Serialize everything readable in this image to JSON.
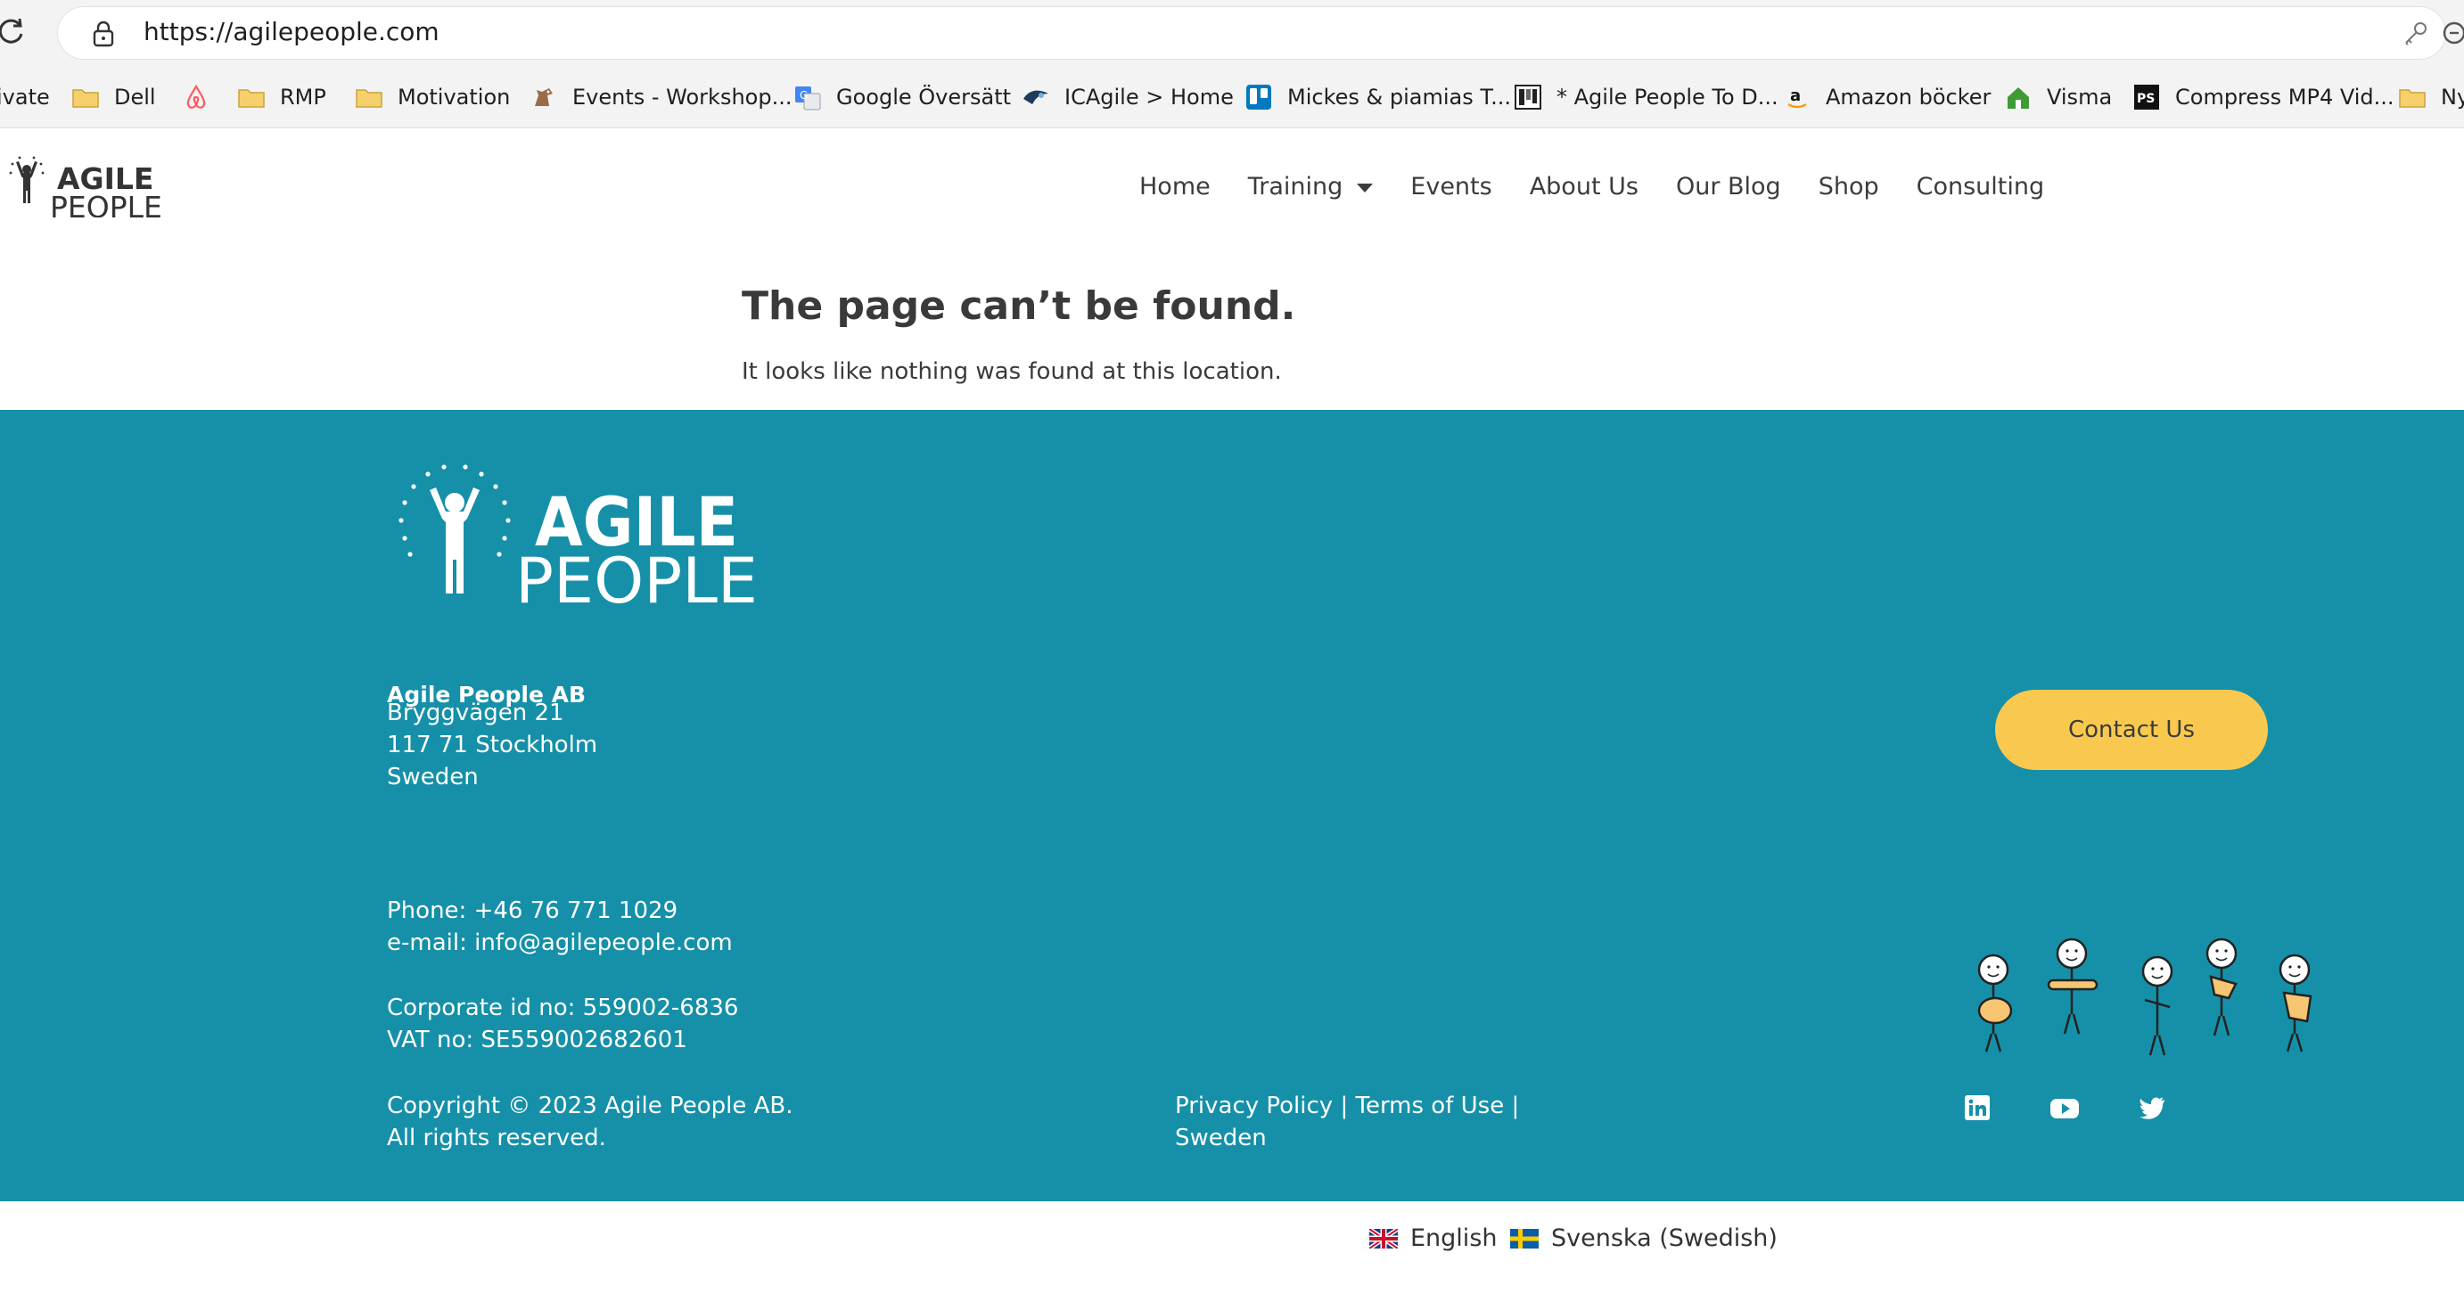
{
  "browser": {
    "url": "https://agilepeople.com",
    "bookmarks": [
      {
        "label": "ivate",
        "icon": "truncated-bookmark"
      },
      {
        "label": "Dell",
        "icon": "folder-icon"
      },
      {
        "label": "",
        "icon": "airbnb-icon"
      },
      {
        "label": "RMP",
        "icon": "folder-icon"
      },
      {
        "label": "Motivation",
        "icon": "folder-icon"
      },
      {
        "label": "Events - Workshop...",
        "icon": "horse-icon"
      },
      {
        "label": "Google Översätt",
        "icon": "google-translate-icon"
      },
      {
        "label": "ICAgile > Home",
        "icon": "icagile-icon"
      },
      {
        "label": "Mickes & piamias T...",
        "icon": "trello-icon"
      },
      {
        "label": "* Agile People To D...",
        "icon": "todo-icon"
      },
      {
        "label": "Amazon böcker",
        "icon": "amazon-icon"
      },
      {
        "label": "Visma",
        "icon": "visma-house-icon"
      },
      {
        "label": "Compress MP4 Vid...",
        "icon": "ps-icon"
      },
      {
        "label": "Ny",
        "icon": "folder-icon"
      }
    ]
  },
  "header": {
    "logo_text_line1": "AGILE",
    "logo_text_line2": "PEOPLE",
    "nav": [
      "Home",
      "Training",
      "Events",
      "About Us",
      "Our Blog",
      "Shop",
      "Consulting"
    ]
  },
  "content": {
    "title": "The page can’t be found.",
    "message": "It looks like nothing was found at this location."
  },
  "footer": {
    "logo_line1": "AGILE",
    "logo_line2": "PEOPLE",
    "company": "Agile People AB",
    "address": [
      "Bryggvägen 21",
      "117 71 Stockholm",
      "Sweden"
    ],
    "phone": "Phone: +46 76 771 1029",
    "email": "e-mail: info@agilepeople.com",
    "corporate_id": "Corporate id no: 559002-6836",
    "vat": "VAT no: SE559002682601",
    "copyright": [
      "Copyright © 2023 Agile People AB.",
      "All rights reserved."
    ],
    "legal_line1": "Privacy Policy | Terms of Use |",
    "legal_line2": "Sweden",
    "contact_button": "Contact Us",
    "social_icons": [
      "linkedin-icon",
      "youtube-icon",
      "twitter-icon"
    ],
    "colors": {
      "background": "#1590a8",
      "button": "#f9c94f"
    }
  },
  "languages": [
    {
      "label": "English",
      "flag": "uk-flag-icon"
    },
    {
      "label": "Svenska (Swedish)",
      "flag": "sweden-flag-icon"
    }
  ]
}
